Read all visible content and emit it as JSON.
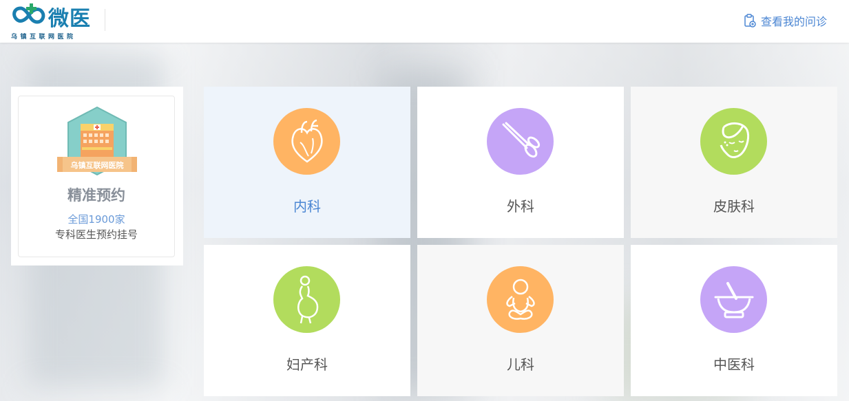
{
  "header": {
    "logo_text": "微医",
    "logo_subtitle": "乌镇互联网医院",
    "my_consult_label": "查看我的问诊"
  },
  "promo": {
    "badge_text": "乌镇互联网医院",
    "title": "精准预约",
    "count": "全国1900家",
    "desc": "专科医生预约挂号"
  },
  "departments": [
    {
      "label": "内科",
      "icon": "heart-icon",
      "color": "#ffb463",
      "bg": "#eef4fb",
      "active": true
    },
    {
      "label": "外科",
      "icon": "scissors-icon",
      "color": "#c5a5f7",
      "bg": "#ffffff"
    },
    {
      "label": "皮肤科",
      "icon": "face-icon",
      "color": "#b2dc5d",
      "bg": "#f7f7f7"
    },
    {
      "label": "妇产科",
      "icon": "pregnant-icon",
      "color": "#b2dc5d",
      "bg": "#ffffff"
    },
    {
      "label": "儿科",
      "icon": "baby-icon",
      "color": "#ffb463",
      "bg": "#f7f7f7"
    },
    {
      "label": "中医科",
      "icon": "mortar-icon",
      "color": "#c5a5f7",
      "bg": "#ffffff"
    }
  ],
  "colors": {
    "brand_blue": "#1a7fb0",
    "brand_green": "#2aa86a",
    "link_blue": "#4b86d3"
  }
}
